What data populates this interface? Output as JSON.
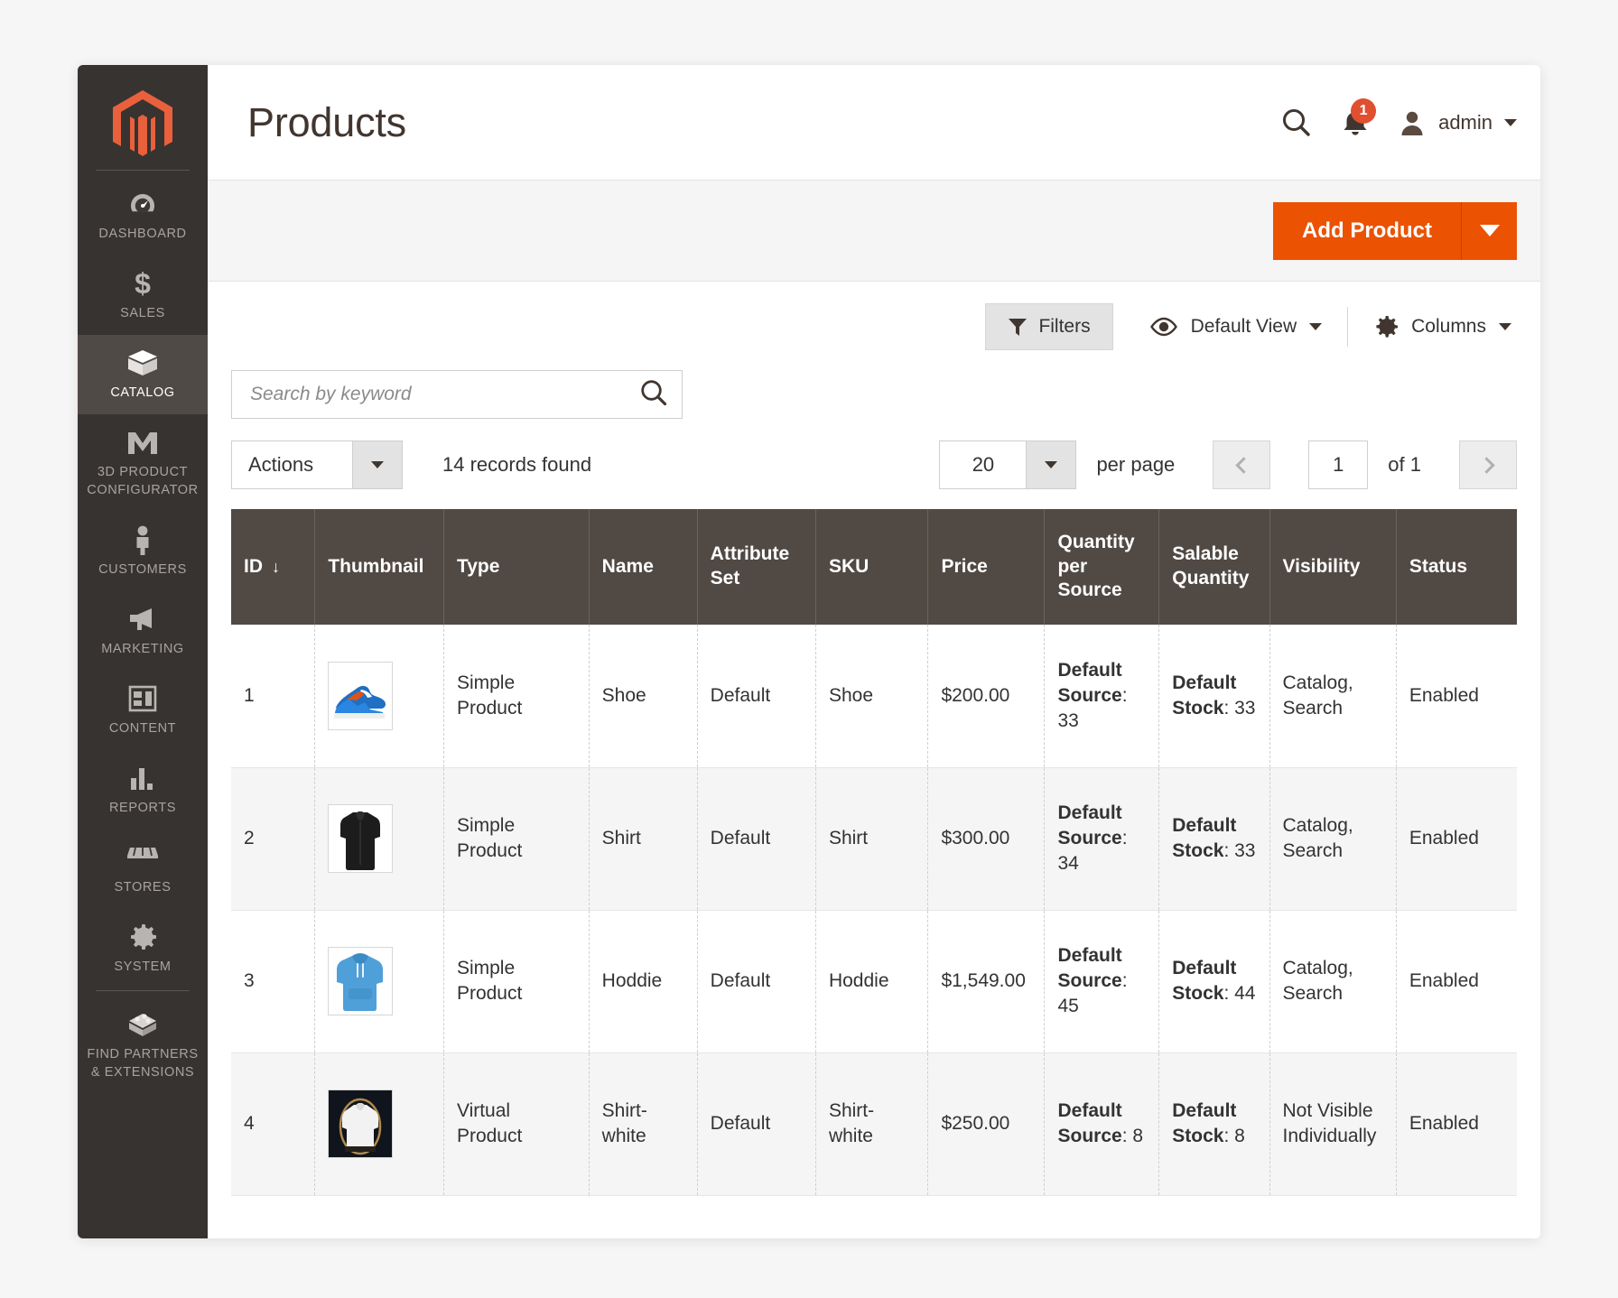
{
  "sidebar": {
    "logo_name": "magento-logo",
    "items": [
      {
        "label": "DASHBOARD",
        "icon": "gauge-icon",
        "active": false
      },
      {
        "label": "SALES",
        "icon": "dollar-icon",
        "active": false
      },
      {
        "label": "CATALOG",
        "icon": "box-icon",
        "active": true
      },
      {
        "label": "3D PRODUCT CONFIGURATOR",
        "icon": "m-logo-icon",
        "active": false
      },
      {
        "label": "CUSTOMERS",
        "icon": "person-icon",
        "active": false
      },
      {
        "label": "MARKETING",
        "icon": "megaphone-icon",
        "active": false
      },
      {
        "label": "CONTENT",
        "icon": "layout-icon",
        "active": false
      },
      {
        "label": "REPORTS",
        "icon": "bar-chart-icon",
        "active": false
      },
      {
        "label": "STORES",
        "icon": "storefront-icon",
        "active": false
      },
      {
        "label": "SYSTEM",
        "icon": "gear-icon",
        "active": false
      },
      {
        "label": "FIND PARTNERS & EXTENSIONS",
        "icon": "extension-box-icon",
        "active": false
      }
    ]
  },
  "header": {
    "title": "Products",
    "search_icon": "search-icon",
    "notifications_icon": "bell-icon",
    "notifications_count": "1",
    "avatar_icon": "user-icon",
    "admin_label": "admin"
  },
  "page_actions": {
    "add_product_label": "Add Product",
    "add_product_toggle_icon": "caret-down-icon"
  },
  "grid_toolbar": {
    "filters_label": "Filters",
    "filters_icon": "funnel-icon",
    "view_icon": "eye-icon",
    "view_label": "Default View",
    "columns_icon": "gear-icon",
    "columns_label": "Columns"
  },
  "search": {
    "placeholder": "Search by keyword",
    "value": "",
    "icon": "search-icon"
  },
  "actions": {
    "actions_label": "Actions",
    "records_found": "14 records found"
  },
  "pagination": {
    "per_page_value": "20",
    "per_page_label": "per page",
    "prev_icon": "chevron-left-icon",
    "current_page": "1",
    "of_label": "of 1",
    "next_icon": "chevron-right-icon"
  },
  "table": {
    "columns": [
      {
        "label": "ID",
        "sort": "↓"
      },
      {
        "label": "Thumbnail",
        "sort": ""
      },
      {
        "label": "Type",
        "sort": ""
      },
      {
        "label": "Name",
        "sort": ""
      },
      {
        "label": "Attribute Set",
        "sort": ""
      },
      {
        "label": "SKU",
        "sort": ""
      },
      {
        "label": "Price",
        "sort": ""
      },
      {
        "label": "Quantity per Source",
        "sort": ""
      },
      {
        "label": "Salable Quantity",
        "sort": ""
      },
      {
        "label": "Visibility",
        "sort": ""
      },
      {
        "label": "Status",
        "sort": ""
      }
    ],
    "rows": [
      {
        "id": "1",
        "thumbnail": "sneaker-thumbnail",
        "type": "Simple Product",
        "name": "Shoe",
        "attribute_set": "Default",
        "sku": "Shoe",
        "price": "$200.00",
        "qty_source_label": "Default Source",
        "qty_source_value": "33",
        "salable_label": "Default Stock",
        "salable_value": "33",
        "visibility": "Catalog, Search",
        "status": "Enabled"
      },
      {
        "id": "2",
        "thumbnail": "black-shirt-thumbnail",
        "type": "Simple Product",
        "name": "Shirt",
        "attribute_set": "Default",
        "sku": "Shirt",
        "price": "$300.00",
        "qty_source_label": "Default Source",
        "qty_source_value": "34",
        "salable_label": "Default Stock",
        "salable_value": "33",
        "visibility": "Catalog, Search",
        "status": "Enabled"
      },
      {
        "id": "3",
        "thumbnail": "blue-hoodie-thumbnail",
        "type": "Simple Product",
        "name": "Hoddie",
        "attribute_set": "Default",
        "sku": "Hoddie",
        "price": "$1,549.00",
        "qty_source_label": "Default Source",
        "qty_source_value": "45",
        "salable_label": "Default Stock",
        "salable_value": "44",
        "visibility": "Catalog, Search",
        "status": "Enabled"
      },
      {
        "id": "4",
        "thumbnail": "white-shirt-thumbnail",
        "type": "Virtual Product",
        "name": "Shirt-white",
        "attribute_set": "Default",
        "sku": "Shirt-white",
        "price": "$250.00",
        "qty_source_label": "Default Source",
        "qty_source_value": "8",
        "salable_label": "Default Stock",
        "salable_value": "8",
        "visibility": "Not Visible Individually",
        "status": "Enabled"
      }
    ]
  },
  "colors": {
    "brand_orange": "#eb5202",
    "sidebar_bg": "#373330",
    "table_header_bg": "#514943",
    "badge_red": "#e04f30"
  }
}
